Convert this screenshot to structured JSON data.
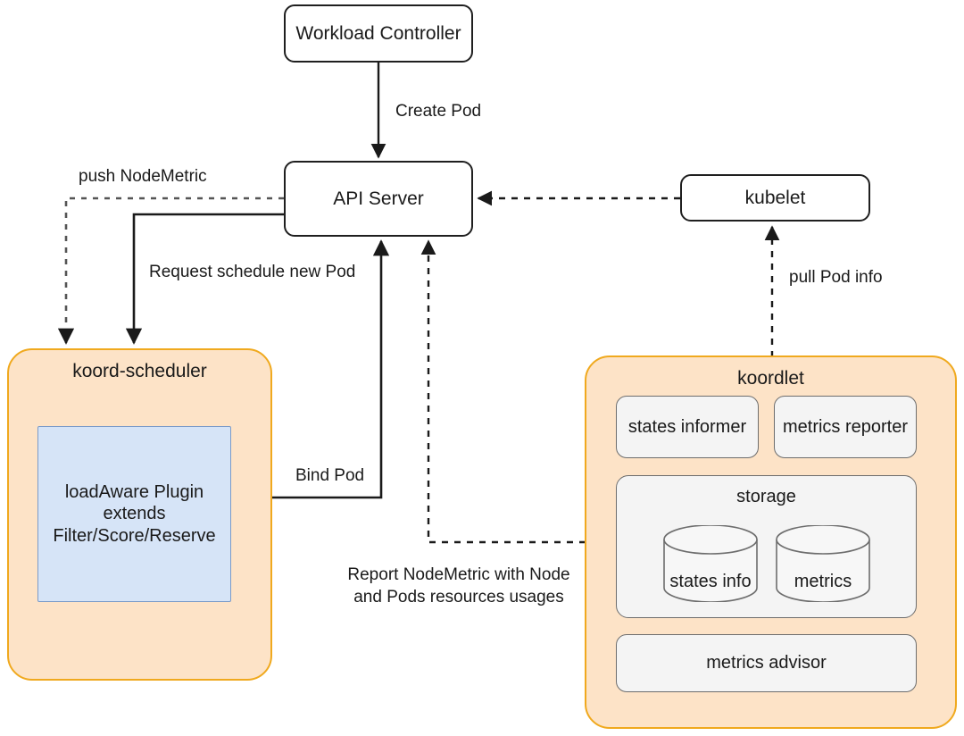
{
  "diagram": {
    "nodes": {
      "workload_controller": "Workload Controller",
      "api_server": "API Server",
      "kubelet": "kubelet",
      "koord_scheduler": "koord-scheduler",
      "koordlet": "koordlet",
      "loadaware_plugin": "loadAware Plugin\nextends\nFilter/Score/Reserve",
      "states_informer": "states informer",
      "metrics_reporter": "metrics reporter",
      "storage": "storage",
      "states_info_store": "states info",
      "metrics_store": "metrics",
      "metrics_advisor": "metrics advisor"
    },
    "edge_labels": {
      "create_pod": "Create Pod",
      "push_nodemetric": "push NodeMetric",
      "request_schedule": "Request schedule new Pod",
      "bind_pod": "Bind Pod",
      "pull_pod_info": "pull Pod info",
      "report_nodemetric": "Report NodeMetric with Node\nand Pods resources usages"
    },
    "colors": {
      "group_fill": "#fde3c7",
      "group_stroke": "#f0a91e",
      "plugin_fill": "#d6e4f7",
      "plugin_stroke": "#7b9bc8",
      "subbox_fill": "#f4f4f4",
      "subbox_stroke": "#6d6d6d",
      "node_stroke": "#1f1f1f",
      "edge_stroke": "#1a1a1a",
      "background": "#ffffff"
    }
  }
}
